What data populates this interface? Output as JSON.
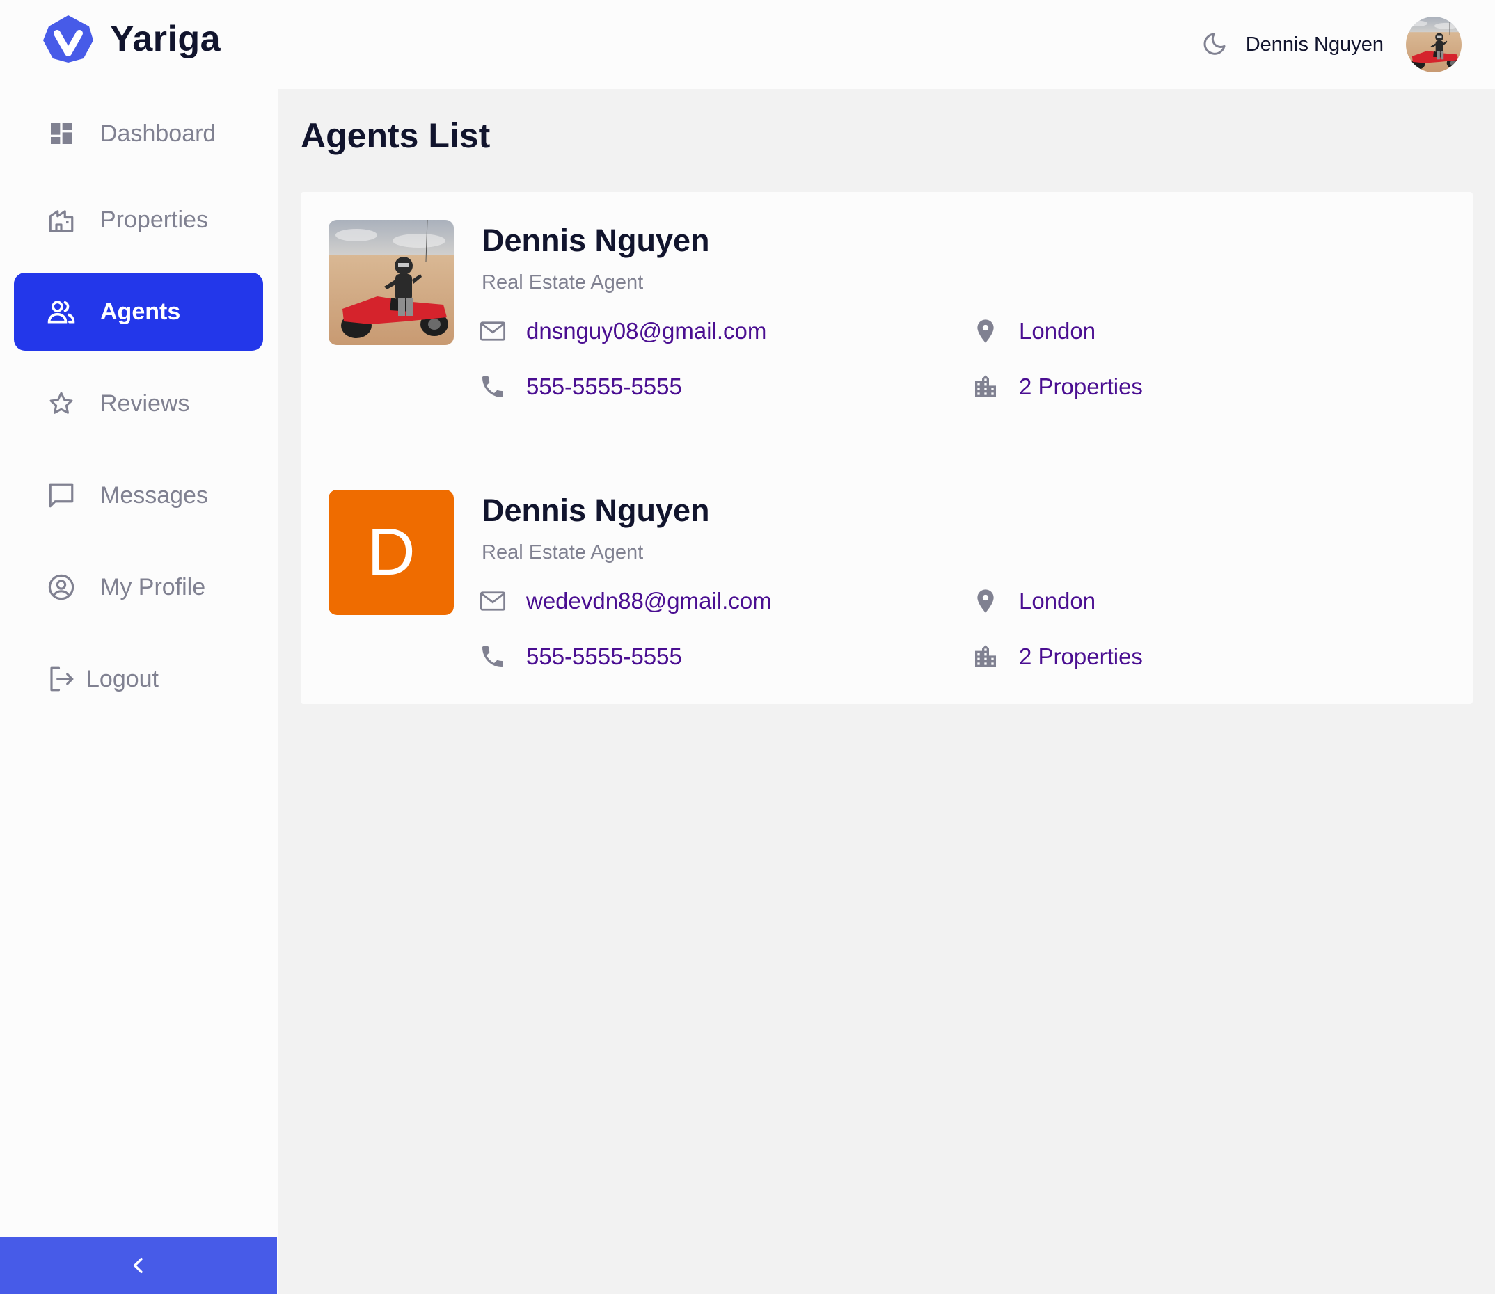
{
  "app": {
    "name": "Yariga"
  },
  "header": {
    "user_name": "Dennis Nguyen"
  },
  "sidebar": {
    "items": [
      {
        "label": "Dashboard",
        "icon": "dashboard-icon"
      },
      {
        "label": "Properties",
        "icon": "properties-icon"
      },
      {
        "label": "Agents",
        "icon": "agents-icon",
        "active": true
      },
      {
        "label": "Reviews",
        "icon": "star-icon"
      },
      {
        "label": "Messages",
        "icon": "message-icon"
      },
      {
        "label": "My Profile",
        "icon": "profile-icon"
      }
    ],
    "logout_label": "Logout"
  },
  "page": {
    "title": "Agents List"
  },
  "agents": [
    {
      "name": "Dennis Nguyen",
      "role": "Real Estate Agent",
      "email": "dnsnguy08@gmail.com",
      "phone": "555-5555-5555",
      "location": "London",
      "properties": "2 Properties",
      "avatar": "photo"
    },
    {
      "name": "Dennis Nguyen",
      "role": "Real Estate Agent",
      "email": "wedevdn88@gmail.com",
      "phone": "555-5555-5555",
      "location": "London",
      "properties": "2 Properties",
      "avatar_initial": "D"
    }
  ],
  "colors": {
    "primary": "#2337ea",
    "collapse_bar": "#475be8",
    "link_text": "#4a0e91",
    "muted_text": "#808191",
    "initial_avatar_bg": "#ef6c00",
    "logo": "#475be8"
  }
}
